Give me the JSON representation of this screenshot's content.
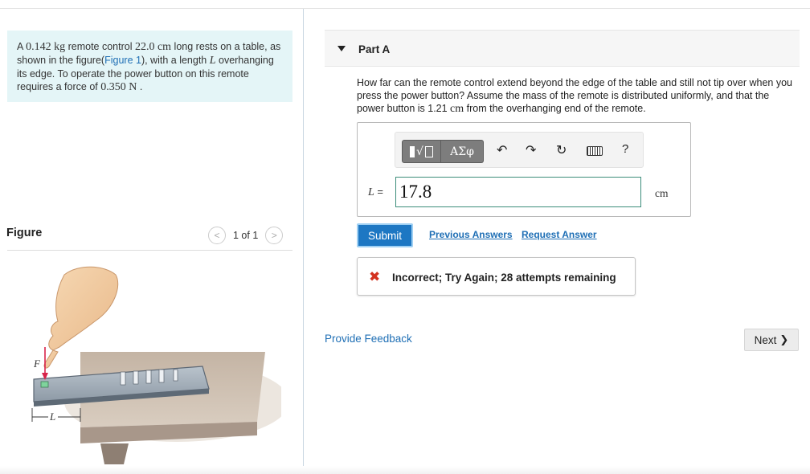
{
  "problem": {
    "text_a": "A ",
    "mass": "0.142 kg",
    "text_b": " remote control ",
    "length": "22.0 cm",
    "text_c": " long rests on a table, as shown in the figure(",
    "figure_link": "Figure 1",
    "text_d": "), with a length ",
    "var_L": "L",
    "text_e": " overhanging its edge. To operate the power button on this remote requires a force of ",
    "force": "0.350 N",
    "text_f": " ."
  },
  "figure": {
    "title": "Figure",
    "pager_text": "1 of 1",
    "prev_icon": "<",
    "next_icon": ">",
    "label_F": "F",
    "label_L": "L"
  },
  "part": {
    "title": "Part A",
    "question_a": "How far can the remote control extend beyond the edge of the table and still not tip over when you press the power button? Assume the mass of the remote is distributed uniformly, and that the power button is 1.21 ",
    "question_unit": "cm",
    "question_b": " from the overhanging end of the remote."
  },
  "toolbar": {
    "templates_sqrt": "√",
    "symbols_label": "ΑΣφ",
    "undo_icon": "↶",
    "redo_icon": "↷",
    "reset_icon": "↻",
    "help_label": "?"
  },
  "answer": {
    "label_var": "L",
    "label_eq": " =",
    "value": "17.8",
    "unit": "cm"
  },
  "actions": {
    "submit": "Submit",
    "previous_answers": "Previous Answers",
    "request_answer": "Request Answer"
  },
  "feedback": {
    "icon": "✖",
    "message": "Incorrect; Try Again; 28 attempts remaining"
  },
  "footer": {
    "provide_feedback": "Provide Feedback",
    "next": "Next",
    "next_icon": "❯"
  }
}
